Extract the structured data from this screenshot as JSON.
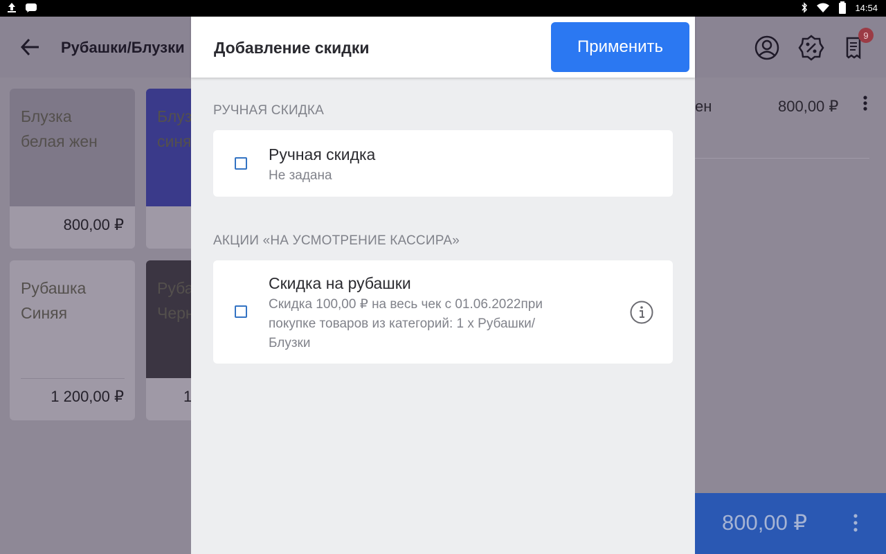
{
  "status_bar": {
    "time": "14:54",
    "left_icons": [
      "upload-icon",
      "message-icon"
    ],
    "right_icons": [
      "bluetooth-icon",
      "wifi-icon",
      "battery-icon"
    ]
  },
  "app_bar": {
    "title": "Рубашки/Блузки",
    "badge_count": "9",
    "icons": [
      "back-arrow-icon",
      "user-circle-icon",
      "discount-percent-icon",
      "receipt-icon"
    ]
  },
  "products": [
    {
      "name_line1": "Блузка",
      "name_line2": "белая жен",
      "price": "800,00 ₽"
    },
    {
      "name_line1": "Блуз",
      "name_line2": "синя",
      "price": ""
    },
    {
      "name_line1": "Рубашка",
      "name_line2": "Синяя",
      "price": "1 200,00 ₽"
    },
    {
      "name_line1": "Рубаш",
      "name_line2": "Черн",
      "price": "1"
    }
  ],
  "cart": {
    "row_name_fragment": "ен",
    "row_price": "800,00 ₽",
    "total": "800,00 ₽"
  },
  "dialog": {
    "title": "Добавление скидки",
    "apply_label": "Применить",
    "manual_section_label": "РУЧНАЯ СКИДКА",
    "manual_item": {
      "title": "Ручная скидка",
      "subtitle": "Не задана",
      "checked": false
    },
    "promo_section_label": "АКЦИИ «НА УСМОТРЕНИЕ КАССИРА»",
    "promo_item": {
      "title": "Скидка на рубашки",
      "desc_line1": "Скидка 100,00 ₽ на весь чек с 01.06.2022при",
      "desc_line2": "покупке товаров из категорий: 1 x Рубашки/",
      "desc_line3": "Блузки",
      "checked": false
    }
  },
  "colors": {
    "accent": "#2b78f2",
    "checkbox": "#3373c3",
    "badge": "#9b3b45"
  }
}
